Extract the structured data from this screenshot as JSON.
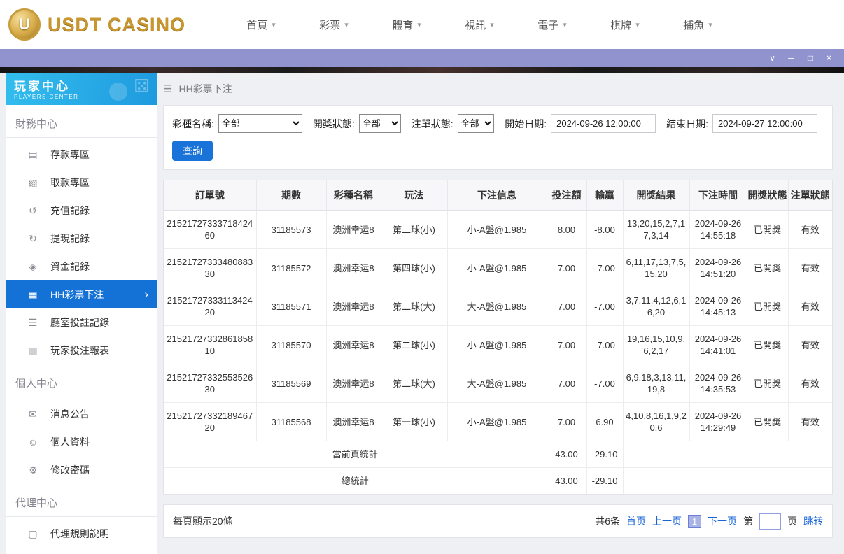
{
  "colors": {
    "accent_blue": "#1a73d9",
    "sidebar_header_blue": "#25aae1",
    "active_item_blue": "#1472d6",
    "titlebar_purple": "#9093cd",
    "logo_gold": "#c9962e",
    "link_blue": "#1a66d9"
  },
  "top_nav": {
    "logo": {
      "coin_letter": "U",
      "text": "USDT CASINO"
    },
    "items": [
      {
        "label": "首頁"
      },
      {
        "label": "彩票"
      },
      {
        "label": "體育"
      },
      {
        "label": "視訊"
      },
      {
        "label": "電子"
      },
      {
        "label": "棋牌"
      },
      {
        "label": "捕魚"
      }
    ]
  },
  "titlebar": {
    "controls": [
      {
        "name": "dropdown",
        "glyph": "∨"
      },
      {
        "name": "minimize",
        "glyph": "─"
      },
      {
        "name": "maximize",
        "glyph": "□"
      },
      {
        "name": "close",
        "glyph": "✕"
      }
    ]
  },
  "sidebar": {
    "title": "玩家中心",
    "subtitle": "PLAYERS CENTER",
    "decoration_glyph": "⚄",
    "sections": [
      {
        "label": "財務中心",
        "items": [
          {
            "id": "deposit",
            "label": "存款專區",
            "icon": "deposit-card-icon",
            "glyph": "▤",
            "active": false
          },
          {
            "id": "withdraw",
            "label": "取款專區",
            "icon": "withdraw-icon",
            "glyph": "▧",
            "active": false
          },
          {
            "id": "recharge-record",
            "label": "充值記錄",
            "icon": "recharge-record-icon",
            "glyph": "↺",
            "active": false
          },
          {
            "id": "withdrawal-record",
            "label": "提現記錄",
            "icon": "withdrawal-record-icon",
            "glyph": "↻",
            "active": false
          },
          {
            "id": "funds-record",
            "label": "資金記錄",
            "icon": "funds-record-icon",
            "glyph": "◈",
            "active": false
          },
          {
            "id": "hh-lottery-bets",
            "label": "HH彩票下注",
            "icon": "lottery-ticket-icon",
            "glyph": "▦",
            "active": true
          },
          {
            "id": "room-bet-record",
            "label": "廳室投註記錄",
            "icon": "room-bet-record-icon",
            "glyph": "☰",
            "active": false
          },
          {
            "id": "player-bet-report",
            "label": "玩家投注報表",
            "icon": "report-icon",
            "glyph": "▥",
            "active": false
          }
        ]
      },
      {
        "label": "個人中心",
        "items": [
          {
            "id": "announcements",
            "label": "消息公告",
            "icon": "announcement-icon",
            "glyph": "✉",
            "active": false
          },
          {
            "id": "profile",
            "label": "個人資料",
            "icon": "user-icon",
            "glyph": "☺",
            "active": false
          },
          {
            "id": "change-password",
            "label": "修改密碼",
            "icon": "gear-icon",
            "glyph": "⚙",
            "active": false
          }
        ]
      },
      {
        "label": "代理中心",
        "items": [
          {
            "id": "agent-rules",
            "label": "代理規則說明",
            "icon": "document-icon",
            "glyph": "▢",
            "active": false
          }
        ]
      }
    ]
  },
  "main": {
    "breadcrumb": {
      "menu_icon": "☰",
      "title": "HH彩票下注"
    },
    "filters": {
      "lottery_label": "彩種名稱:",
      "lottery_value": "全部",
      "draw_status_label": "開獎狀態:",
      "draw_status_value": "全部",
      "bet_status_label": "注單狀態:",
      "bet_status_value": "全部",
      "start_date_label": "開始日期:",
      "start_date_value": "2024-09-26 12:00:00",
      "end_date_label": "結束日期:",
      "end_date_value": "2024-09-27 12:00:00",
      "search_label": "查詢"
    },
    "table": {
      "headers": [
        "訂單號",
        "期數",
        "彩種名稱",
        "玩法",
        "下注信息",
        "投注額",
        "輸贏",
        "開獎結果",
        "下注時間",
        "開獎狀態",
        "注單狀態"
      ],
      "rows": [
        {
          "order_no": "2152172733371842460",
          "period": "31185573",
          "lottery": "澳洲幸运8",
          "play": "第二球(小)",
          "bet_info": "小-A盤@1.985",
          "amount": "8.00",
          "winloss": "-8.00",
          "result": "13,20,15,2,7,17,3,14",
          "time": "2024-09-26 14:55:18",
          "draw_status": "已開獎",
          "bet_status": "有效"
        },
        {
          "order_no": "2152172733348088330",
          "period": "31185572",
          "lottery": "澳洲幸运8",
          "play": "第四球(小)",
          "bet_info": "小-A盤@1.985",
          "amount": "7.00",
          "winloss": "-7.00",
          "result": "6,11,17,13,7,5,15,20",
          "time": "2024-09-26 14:51:20",
          "draw_status": "已開獎",
          "bet_status": "有效"
        },
        {
          "order_no": "2152172733311342420",
          "period": "31185571",
          "lottery": "澳洲幸运8",
          "play": "第二球(大)",
          "bet_info": "大-A盤@1.985",
          "amount": "7.00",
          "winloss": "-7.00",
          "result": "3,7,11,4,12,6,16,20",
          "time": "2024-09-26 14:45:13",
          "draw_status": "已開獎",
          "bet_status": "有效"
        },
        {
          "order_no": "2152172733286185810",
          "period": "31185570",
          "lottery": "澳洲幸运8",
          "play": "第二球(小)",
          "bet_info": "小-A盤@1.985",
          "amount": "7.00",
          "winloss": "-7.00",
          "result": "19,16,15,10,9,6,2,17",
          "time": "2024-09-26 14:41:01",
          "draw_status": "已開獎",
          "bet_status": "有效"
        },
        {
          "order_no": "2152172733255352630",
          "period": "31185569",
          "lottery": "澳洲幸运8",
          "play": "第二球(大)",
          "bet_info": "大-A盤@1.985",
          "amount": "7.00",
          "winloss": "-7.00",
          "result": "6,9,18,3,13,11,19,8",
          "time": "2024-09-26 14:35:53",
          "draw_status": "已開獎",
          "bet_status": "有效"
        },
        {
          "order_no": "2152172733218946720",
          "period": "31185568",
          "lottery": "澳洲幸运8",
          "play": "第一球(小)",
          "bet_info": "小-A盤@1.985",
          "amount": "7.00",
          "winloss": "6.90",
          "result": "4,10,8,16,1,9,20,6",
          "time": "2024-09-26 14:29:49",
          "draw_status": "已開獎",
          "bet_status": "有效"
        }
      ],
      "page_summary": {
        "label": "當前頁統計",
        "amount": "43.00",
        "winloss": "-29.10"
      },
      "total_summary": {
        "label": "總統計",
        "amount": "43.00",
        "winloss": "-29.10"
      }
    },
    "footer": {
      "page_size_text": "每頁顯示20條",
      "total_text": "共6条",
      "first_label": "首页",
      "prev_label": "上一页",
      "current_page": "1",
      "next_label": "下一页",
      "jump_prefix": "第",
      "jump_suffix": "页",
      "jump_label": "跳转"
    }
  }
}
